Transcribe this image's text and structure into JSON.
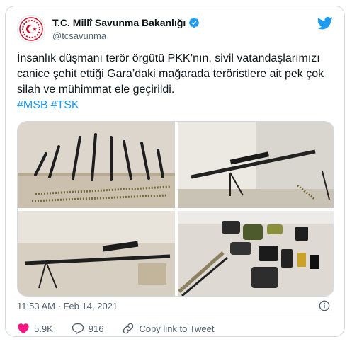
{
  "account": {
    "display_name": "T.C. Millî Savunma Bakanlığı",
    "handle": "@tcsavunma",
    "verified_icon": "verified-badge-icon",
    "avatar_icon": "crescent-star-emblem-icon"
  },
  "brand_icon": "twitter-bird-icon",
  "tweet": {
    "text": "İnsanlık düşmanı terör örgütü PKK’nın, sivil vatandaşlarımızı canice şehit ettiği Gara’daki mağarada teröristlere ait pek çok silah ve mühimmat ele geçirildi.",
    "hashtags": [
      "#MSB",
      "#TSK"
    ]
  },
  "media": {
    "photos": [
      {
        "subject": "row of rifles leaning against wall with ammunition belts"
      },
      {
        "subject": "sniper rifle with scope on bipod"
      },
      {
        "subject": "rifle with scope on bipod on floor"
      },
      {
        "subject": "assorted equipment, radios and gear on floor"
      }
    ]
  },
  "meta": {
    "timestamp": "11:53 AM · Feb 14, 2021"
  },
  "actions": {
    "likes": "5.9K",
    "replies": "916",
    "copy_link": "Copy link to Tweet"
  },
  "colors": {
    "accent": "#1d9bf0",
    "like": "#f91880",
    "text": "#0f1419",
    "muted": "#536471"
  }
}
